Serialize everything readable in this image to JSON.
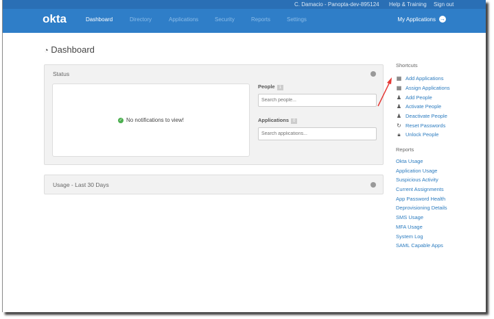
{
  "topbar": {
    "user": "C. Damacio - Panopta-dev-895124",
    "help": "Help & Training",
    "signout": "Sign out"
  },
  "nav": {
    "logo": "okta",
    "items": [
      "Dashboard",
      "Directory",
      "Applications",
      "Security",
      "Reports",
      "Settings"
    ],
    "my_apps": "My Applications"
  },
  "page_title": "Dashboard",
  "status": {
    "title": "Status",
    "notification": "No notifications to view!",
    "people_label": "People",
    "people_count": "1",
    "people_placeholder": "Search people...",
    "apps_label": "Applications",
    "apps_count": "0",
    "apps_placeholder": "Search applications..."
  },
  "usage": {
    "title": "Usage - Last 30 Days"
  },
  "shortcuts": {
    "title": "Shortcuts",
    "items": [
      {
        "label": "Add Applications",
        "icon": "grid-plus-icon"
      },
      {
        "label": "Assign Applications",
        "icon": "grid-assign-icon"
      },
      {
        "label": "Add People",
        "icon": "person-plus-icon"
      },
      {
        "label": "Activate People",
        "icon": "person-check-icon"
      },
      {
        "label": "Deactivate People",
        "icon": "person-x-icon"
      },
      {
        "label": "Reset Passwords",
        "icon": "refresh-icon"
      },
      {
        "label": "Unlock People",
        "icon": "lock-icon"
      }
    ]
  },
  "reports": {
    "title": "Reports",
    "items": [
      "Okta Usage",
      "Application Usage",
      "Suspicious Activity",
      "Current Assignments",
      "App Password Health",
      "Deprovisioning Details",
      "SMS Usage",
      "MFA Usage",
      "System Log",
      "SAML Capable Apps"
    ]
  },
  "colors": {
    "nav": "#2f7ec8",
    "link": "#2b7bbf",
    "annotation": "#e53935"
  }
}
